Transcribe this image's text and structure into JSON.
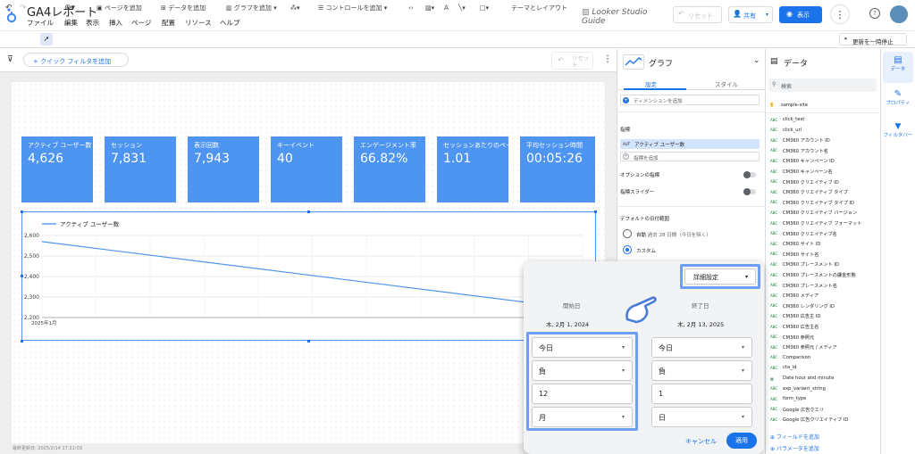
{
  "app": {
    "title": "GA4レポート",
    "menu": [
      "ファイル",
      "編集",
      "表示",
      "挿入",
      "ページ",
      "配置",
      "リソース",
      "ヘルプ"
    ],
    "brand": "Looker Studio Guide",
    "reset": "リセット",
    "share": "共有",
    "view": "表示",
    "accent": "#1a73e8"
  },
  "toolbar": {
    "add_page": "ページを追加",
    "add_data": "データを追加",
    "add_chart": "グラフを追加",
    "add_control": "コントロールを追加",
    "theme_layout": "テーマとレイアウト",
    "pause_update": "更新を一時停止"
  },
  "filterbar": {
    "quick_filter": "+ クイック フィルタを追加",
    "reset_label": "リセット"
  },
  "scorecards": [
    {
      "label": "アクティブ ユーザー数",
      "value": "4,626"
    },
    {
      "label": "セッション",
      "value": "7,831"
    },
    {
      "label": "表示回数",
      "value": "7,943"
    },
    {
      "label": "キーイベント",
      "value": "40"
    },
    {
      "label": "エンゲージメント率",
      "value": "66.82%"
    },
    {
      "label": "セッションあたりのページ",
      "value": "1.01"
    },
    {
      "label": "平均セッション時間",
      "value": "00:05:26"
    }
  ],
  "chart_data": {
    "type": "line",
    "series": [
      {
        "name": "アクティブ ユーザー数",
        "values": [
          2570,
          2240
        ]
      }
    ],
    "x": [
      "2025年1月",
      ""
    ],
    "ylim": [
      2200,
      2600
    ],
    "yticks": [
      "2,600",
      "2,500",
      "2,400",
      "2,300",
      "2,200"
    ],
    "title": "",
    "xlabel": "",
    "ylabel": "",
    "grid": true,
    "legend": "top-left",
    "color": "#4e95f1"
  },
  "last_updated": "最終更新日: 2025/2/14 17:22:03",
  "chart_panel": {
    "title": "グラフ",
    "tab_setup": "設定",
    "tab_style": "スタイル",
    "add_dimension": "ディメンションを追加",
    "metric_heading": "指標",
    "metric_tag": "AUT",
    "metric": "アクティブ ユーザー数",
    "add_metric": "指標を追加",
    "optional_metrics": "オプションの指標",
    "metric_slider": "指標スライダー",
    "date_range_heading": "デフォルトの日付範囲",
    "auto_label": "自動",
    "auto_desc": "過去 28 日間（今日を除く）",
    "custom_label": "カスタム"
  },
  "data_panel": {
    "title": "データ",
    "search_placeholder": "検索",
    "source": "sample-site",
    "fields": [
      "click_text",
      "click_url",
      "CM360 アカウント ID",
      "CM360 アカウント名",
      "CM360 キャンペーン ID",
      "CM360 キャンペーン名",
      "CM360 クリエイティブ ID",
      "CM360 クリエイティブ タイプ",
      "CM360 クリエイティブ タイプ ID",
      "CM360 クリエイティブ バージョン",
      "CM360 クリエイティブ フォーマット",
      "CM360 クリエイティブ名",
      "CM360 サイト ID",
      "CM360 サイト名",
      "CM360 プレースメント ID",
      "CM360 プレースメントの課金形態",
      "CM360 プレースメント名",
      "CM360 メディア",
      "CM360 レンダリング ID",
      "CM360 広告主 ID",
      "CM360 広告主名",
      "CM360 参照元",
      "CM360 参照元 / メディア",
      "Comparison",
      "cta_id",
      "Date hour and minute",
      "exp_variant_string",
      "form_type",
      "Google 広告クエリ",
      "Google 広告クリエイティブ ID"
    ],
    "add_field": "フィールドを追加",
    "add_param": "パラメータを追加"
  },
  "right_rail": {
    "data": "データ",
    "properties": "プロパティ",
    "filter_bar": "フィルタバー"
  },
  "date_popup": {
    "advanced": "詳細設定",
    "start_label": "開始日",
    "end_label": "終了日",
    "start_date": "木, 2月 1, 2024",
    "end_date": "木, 2月 13, 2025",
    "start": {
      "anchor": "今日",
      "direction": "負",
      "amount": "12",
      "unit": "月"
    },
    "end": {
      "anchor": "今日",
      "direction": "負",
      "amount": "1",
      "unit": "日"
    },
    "cancel": "キャンセル",
    "apply": "適用"
  }
}
